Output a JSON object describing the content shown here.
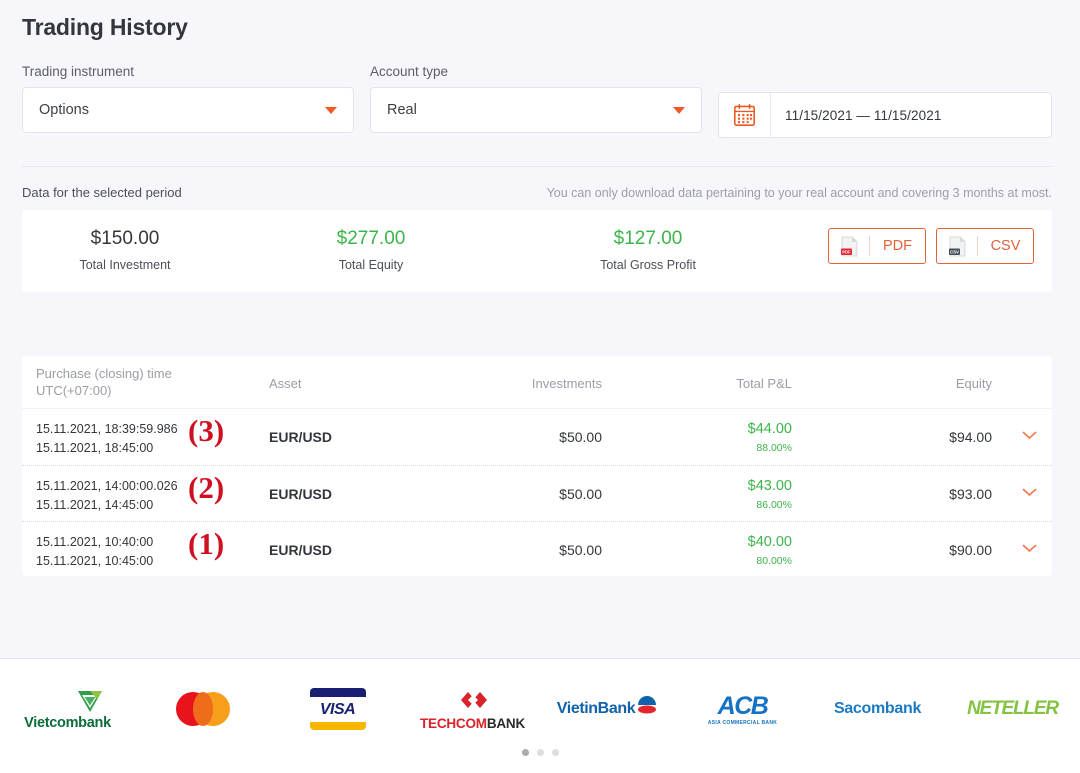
{
  "header": {
    "title": "Trading History"
  },
  "filters": {
    "instrument": {
      "label": "Trading instrument",
      "value": "Options",
      "caret_icon": "caret-down-icon"
    },
    "account": {
      "label": "Account type",
      "value": "Real",
      "caret_icon": "caret-down-icon"
    },
    "date_range": {
      "value": "11/15/2021 — 11/15/2021",
      "icon": "calendar-icon"
    }
  },
  "period": {
    "label": "Data for the selected period",
    "note": "You can only download data pertaining to your real account and covering 3 months at most."
  },
  "stats": [
    {
      "value": "$150.00",
      "label": "Total Investment",
      "tone": "neutral"
    },
    {
      "value": "$277.00",
      "label": "Total Equity",
      "tone": "positive"
    },
    {
      "value": "$127.00",
      "label": "Total Gross Profit",
      "tone": "positive"
    }
  ],
  "downloads": [
    {
      "label": "PDF",
      "icon": "pdf-file-icon",
      "badge": "PDF",
      "badge_color": "#e8222c"
    },
    {
      "label": "CSV",
      "icon": "csv-file-icon",
      "badge": "CSV",
      "badge_color": "#4a4f57"
    }
  ],
  "table": {
    "columns": {
      "time_line1": "Purchase (closing) time",
      "time_line2": "UTC(+07:00)",
      "asset": "Asset",
      "investments": "Investments",
      "total_pl": "Total P&L",
      "equity": "Equity"
    },
    "rows": [
      {
        "marker": "(3)",
        "open_time": "15.11.2021, 18:39:59.986",
        "close_time": "15.11.2021, 18:45:00",
        "asset": "EUR/USD",
        "investment": "$50.00",
        "pl_value": "$44.00",
        "pl_percent": "88.00%",
        "equity": "$94.00",
        "expand_icon": "chevron-down-icon"
      },
      {
        "marker": "(2)",
        "open_time": "15.11.2021, 14:00:00.026",
        "close_time": "15.11.2021, 14:45:00",
        "asset": "EUR/USD",
        "investment": "$50.00",
        "pl_value": "$43.00",
        "pl_percent": "86.00%",
        "equity": "$93.00",
        "expand_icon": "chevron-down-icon"
      },
      {
        "marker": "(1)",
        "open_time": "15.11.2021, 10:40:00",
        "close_time": "15.11.2021, 10:45:00",
        "asset": "EUR/USD",
        "investment": "$50.00",
        "pl_value": "$40.00",
        "pl_percent": "80.00%",
        "equity": "$90.00",
        "expand_icon": "chevron-down-icon"
      }
    ]
  },
  "footer": {
    "logos": [
      {
        "name": "Vietcombank"
      },
      {
        "name": "Mastercard"
      },
      {
        "name": "VISA"
      },
      {
        "name": "TECHCOMBANK",
        "part1": "TECHCOM",
        "part2": "BANK"
      },
      {
        "name": "VietinBank"
      },
      {
        "name": "ACB",
        "subtitle": "ASIA COMMERCIAL BANK"
      },
      {
        "name": "Sacombank"
      },
      {
        "name": "NETELLER"
      }
    ],
    "carousel_dots": 3,
    "active_dot": 0
  },
  "colors": {
    "accent": "#ef5a24",
    "positive": "#3cb54a",
    "marker": "#cf1020",
    "page_bg": "#f7f7fb"
  }
}
